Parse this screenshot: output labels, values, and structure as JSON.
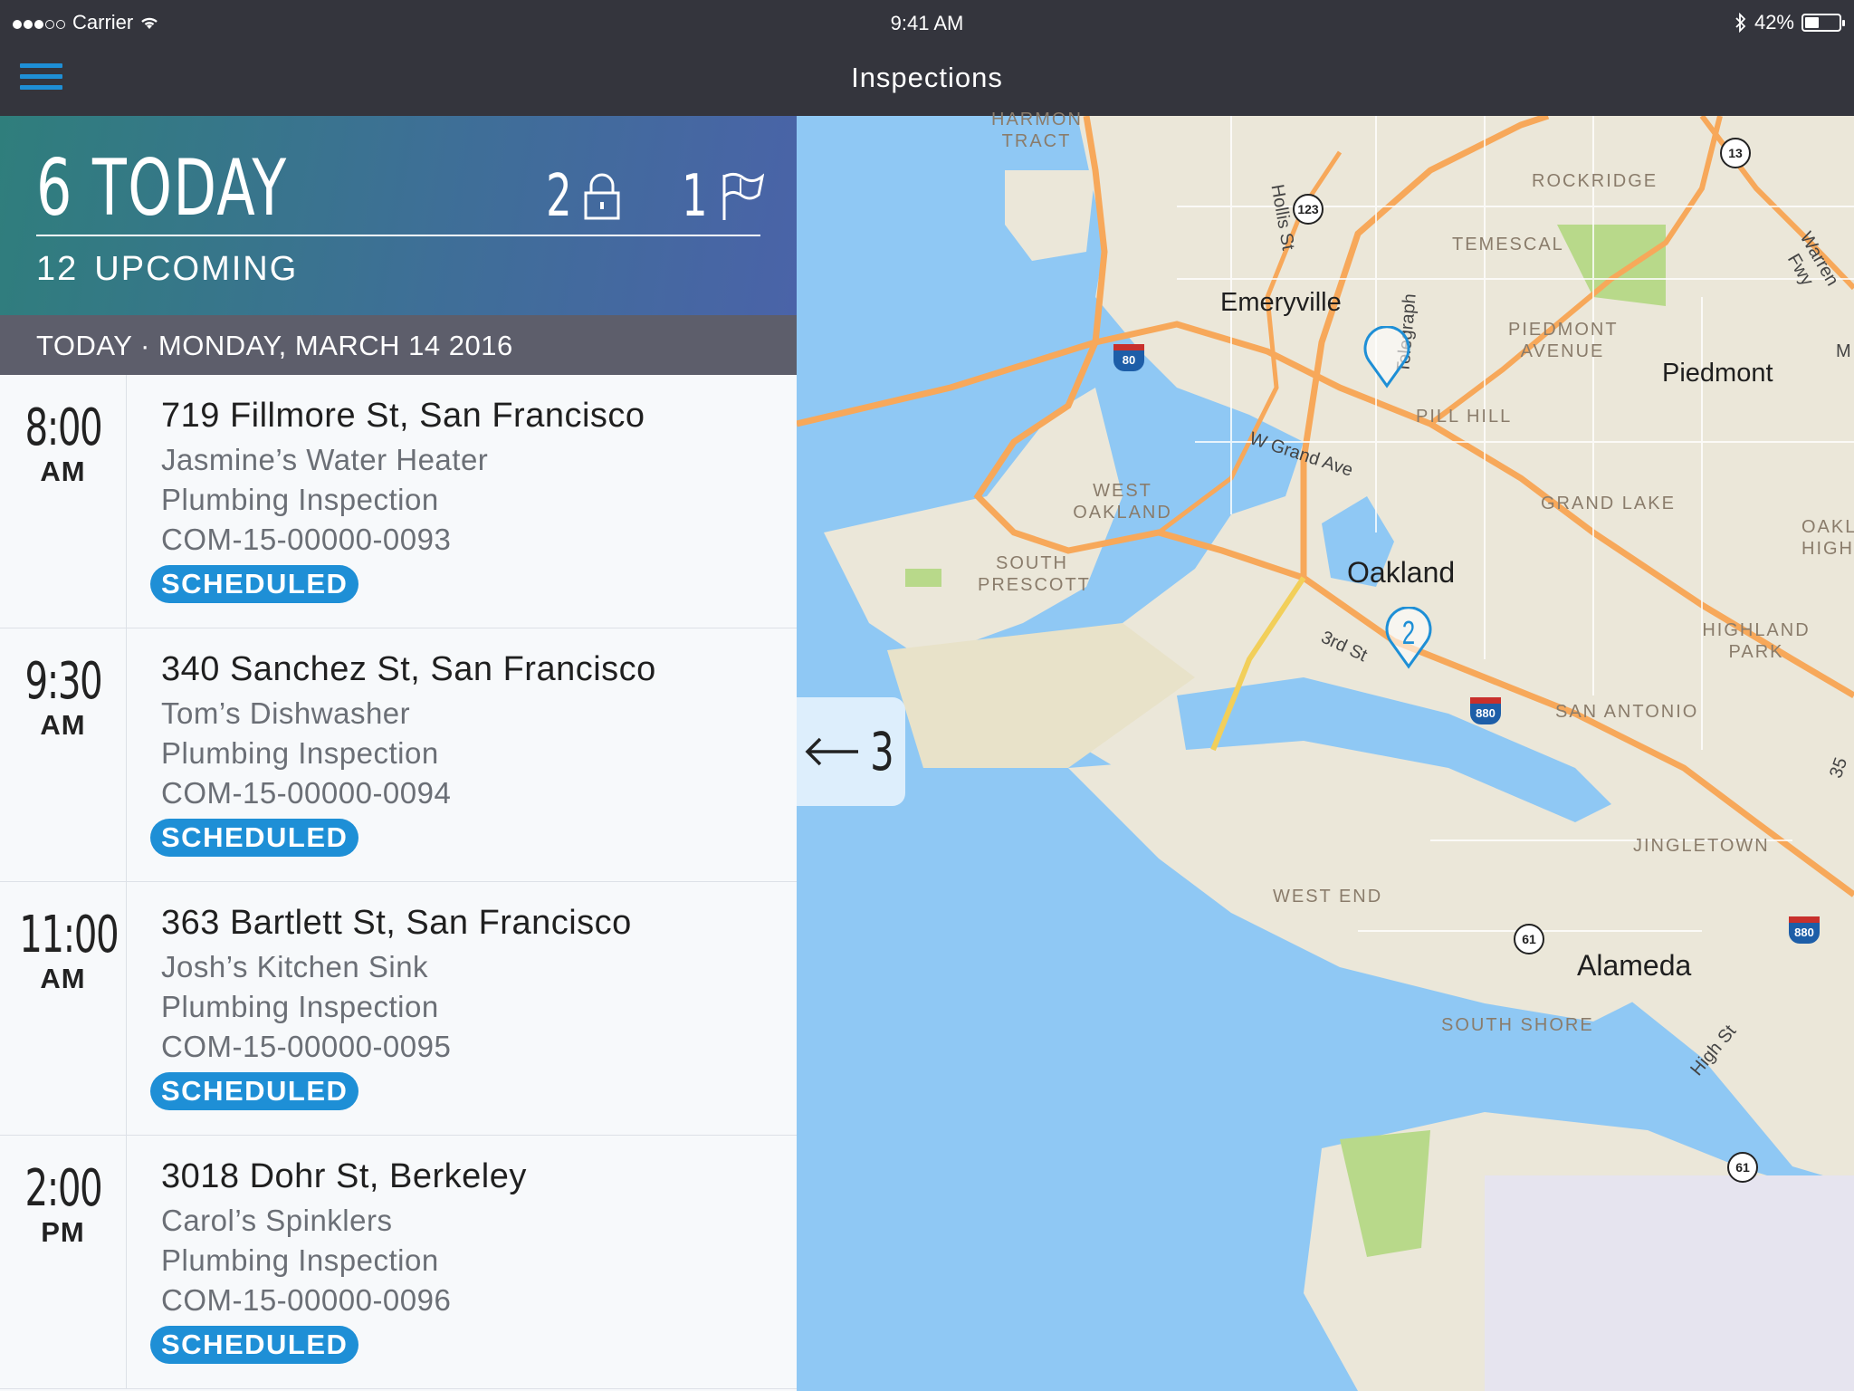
{
  "status_bar": {
    "carrier": "Carrier",
    "time": "9:41 AM",
    "battery": "42%",
    "battery_level": 0.42
  },
  "nav": {
    "title": "Inspections"
  },
  "summary": {
    "today_count": "6",
    "today_label": "TODAY",
    "locked_count": "2",
    "flagged_count": "1",
    "upcoming_count": "12",
    "upcoming_label": "UPCOMING"
  },
  "date_header": "TODAY · MONDAY, MARCH 14 2016",
  "inspections": [
    {
      "time": "8:00",
      "ampm": "AM",
      "address": "719 Fillmore St, San Francisco",
      "name": "Jasmine’s Water Heater",
      "type": "Plumbing Inspection",
      "id": "COM-15-00000-0093",
      "status": "SCHEDULED"
    },
    {
      "time": "9:30",
      "ampm": "AM",
      "address": "340 Sanchez St, San Francisco",
      "name": "Tom’s Dishwasher",
      "type": "Plumbing Inspection",
      "id": "COM-15-00000-0094",
      "status": "SCHEDULED"
    },
    {
      "time": "11:00",
      "ampm": "AM",
      "address": "363 Bartlett St, San Francisco",
      "name": "Josh’s Kitchen Sink",
      "type": "Plumbing Inspection",
      "id": "COM-15-00000-0095",
      "status": "SCHEDULED"
    },
    {
      "time": "2:00",
      "ampm": "PM",
      "address": "3018 Dohr St, Berkeley",
      "name": "Carol’s Spinklers",
      "type": "Plumbing Inspection",
      "id": "COM-15-00000-0096",
      "status": "SCHEDULED"
    }
  ],
  "pull_tab": {
    "count": "3"
  },
  "map": {
    "cities": [
      "Emeryville",
      "Oakland",
      "Piedmont",
      "Alameda"
    ],
    "neighborhoods": [
      "HARMON TRACT",
      "ROCKRIDGE",
      "TEMESCAL",
      "PIEDMONT AVENUE",
      "PILL HILL",
      "WEST OAKLAND",
      "GRAND LAKE",
      "SOUTH PRESCOTT",
      "OAKLAND HIGHLANDS",
      "HIGHLAND PARK",
      "SAN ANTONIO",
      "JINGLETOWN",
      "WEST END",
      "SOUTH SHORE"
    ],
    "streets": [
      "Hollis St",
      "W Grand Ave",
      "3rd St",
      "High St",
      "Warren Fwy",
      "Telegraph",
      "M"
    ],
    "shields": [
      "13",
      "123",
      "80",
      "880",
      "61",
      "35"
    ],
    "pins": [
      "",
      "2"
    ],
    "colors": {
      "water": "#8fc8f4",
      "land": "#ebe7d9",
      "highway": "#f7a85a",
      "pin": "#1e8fd6",
      "park": "#b8d98a"
    }
  },
  "colors": {
    "accent": "#1e8fd6",
    "topbar": "#34353d",
    "date_header": "#5d5e6b"
  }
}
